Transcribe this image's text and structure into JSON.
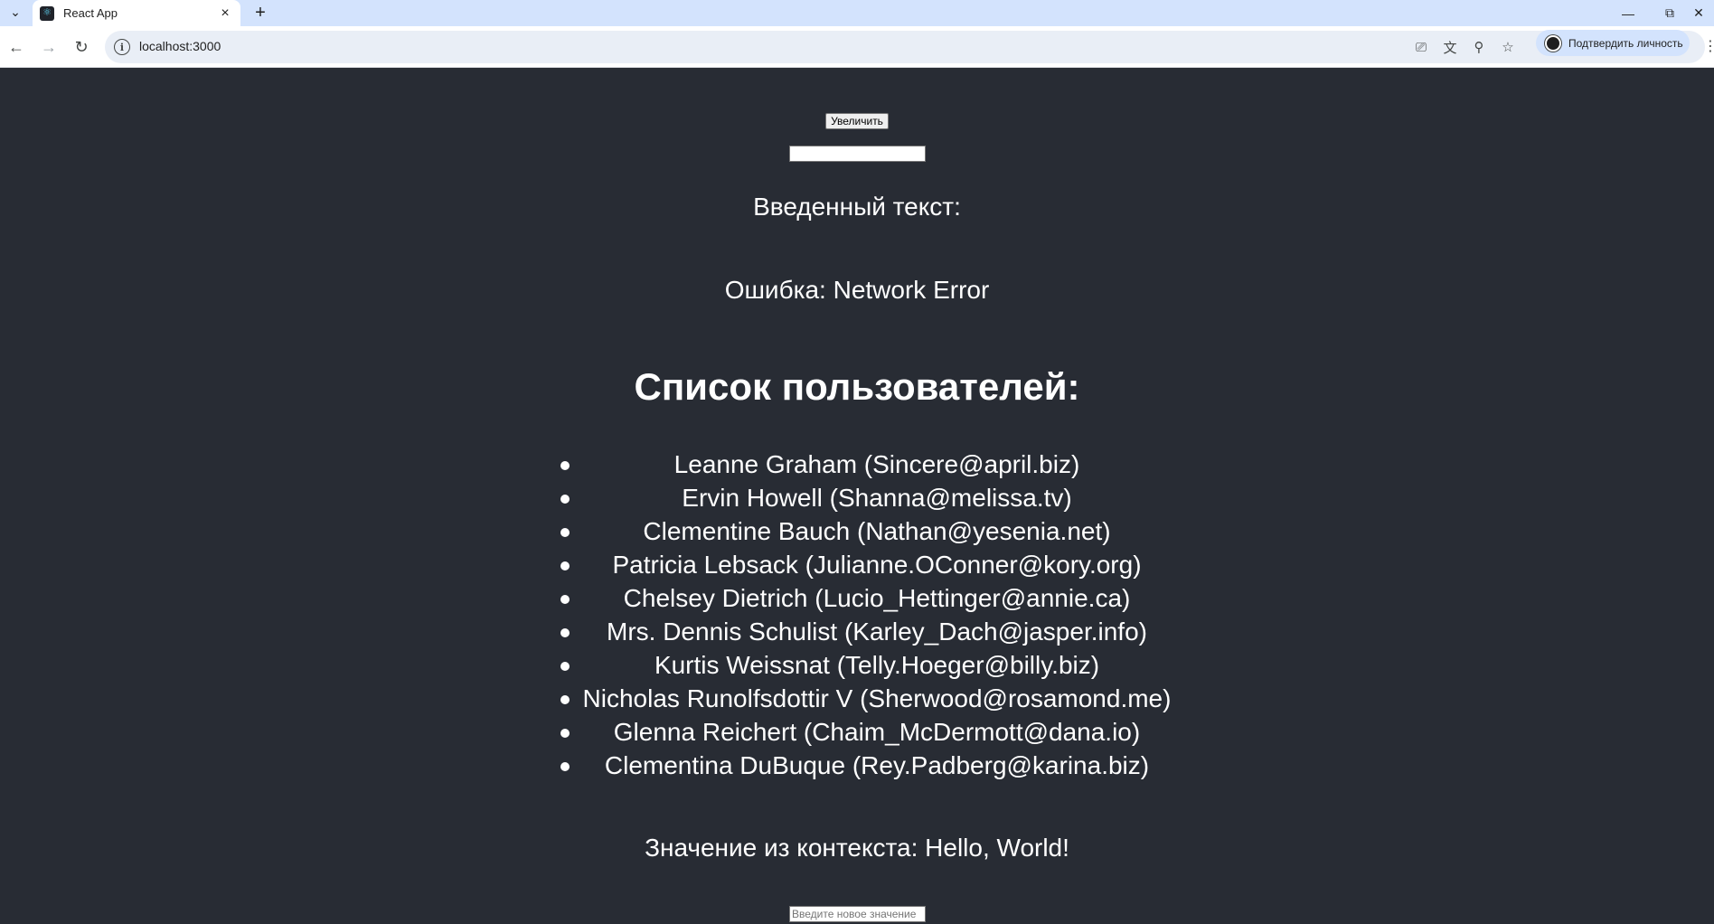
{
  "browser": {
    "tab_title": "React App",
    "url": "localhost:3000",
    "profile_label": "Подтвердить личность"
  },
  "page": {
    "increase_button": "Увеличить",
    "text_input_value": "",
    "entered_text_label": "Введенный текст:",
    "error_text": "Ошибка: Network Error",
    "users_heading": "Список пользователей:",
    "users": [
      "Leanne Graham (Sincere@april.biz)",
      "Ervin Howell (Shanna@melissa.tv)",
      "Clementine Bauch (Nathan@yesenia.net)",
      "Patricia Lebsack (Julianne.OConner@kory.org)",
      "Chelsey Dietrich (Lucio_Hettinger@annie.ca)",
      "Mrs. Dennis Schulist (Karley_Dach@jasper.info)",
      "Kurtis Weissnat (Telly.Hoeger@billy.biz)",
      "Nicholas Runolfsdottir V (Sherwood@rosamond.me)",
      "Glenna Reichert (Chaim_McDermott@dana.io)",
      "Clementina DuBuque (Rey.Padberg@karina.biz)"
    ],
    "context_text": "Значение из контекста: Hello, World!",
    "context_input_placeholder": "Введите новое значение"
  },
  "colors": {
    "page_background": "#282c34",
    "tabstrip_background": "#d3e3fd",
    "omnibox_background": "#e9eef6"
  }
}
